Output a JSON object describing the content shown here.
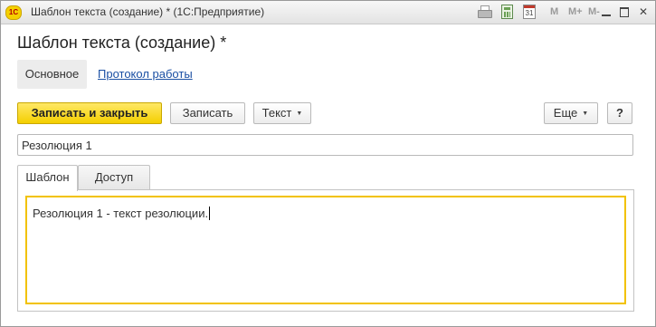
{
  "window": {
    "logo_text": "1С",
    "title": "Шаблон текста (создание) *  (1С:Предприятие)",
    "calendar_day": "31",
    "memory_buttons": [
      "M",
      "M+",
      "M-"
    ]
  },
  "form": {
    "title": "Шаблон текста (создание) *"
  },
  "nav_tabs": {
    "main": "Основное",
    "log": "Протокол работы"
  },
  "toolbar": {
    "save_close_label": "Записать и закрыть",
    "save_label": "Записать",
    "text_label": "Текст",
    "more_label": "Еще",
    "help_label": "?"
  },
  "name_field": {
    "value": "Резолюция 1"
  },
  "content_tabs": {
    "template": "Шаблон",
    "access": "Доступ"
  },
  "editor": {
    "text": "Резолюция 1 - текст резолюции."
  },
  "colors": {
    "accent_button": "#f4cf00",
    "editor_border": "#f2c200",
    "link": "#1a4fa3"
  }
}
